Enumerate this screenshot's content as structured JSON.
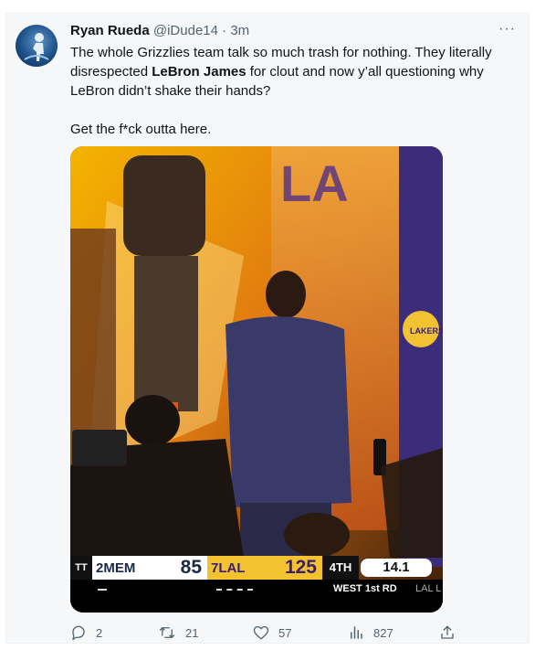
{
  "tweet": {
    "author_name": "Ryan Rueda",
    "handle": "@iDude14",
    "separator": " · ",
    "time": "3m",
    "more_label": "···",
    "text_line1_pre": "The whole Grizzlies team talk so much trash for nothing. They literally disrespected ",
    "text_bold": "LeBron James",
    "text_line1_post": " for clout and now y’all questioning why LeBron didn’t shake their hands?",
    "text_line2": "Get the f*ck outta here."
  },
  "scoreboard": {
    "network_logo": "TT",
    "away_seed": "2",
    "away_team": "MEM",
    "away_score": "85",
    "home_seed": "7",
    "home_team": "LAL",
    "home_score": "125",
    "period": "4TH",
    "clock": "14.1",
    "series": "WEST 1st RD",
    "series_tag": "LAL L"
  },
  "media_text": {
    "floor_logo": "LAKERS",
    "banner_letters": "LA"
  },
  "actions": {
    "replies": "2",
    "retweets": "21",
    "likes": "57",
    "views": "827"
  },
  "colors": {
    "text": "#0f1419",
    "secondary": "#536471",
    "lakers_gold": "#f2c230",
    "lakers_purple": "#3b1f6e"
  }
}
